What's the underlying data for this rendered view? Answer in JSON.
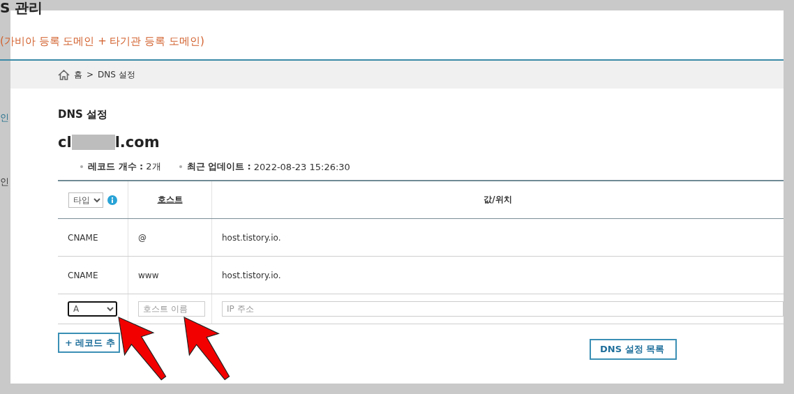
{
  "page_title": "S 관리",
  "subtitle": "(가비아 등록 도메인 + 타기관 등록 도메인)",
  "sidebar": {
    "items": [
      {
        "label": "인",
        "selected": true
      },
      {
        "label": "인",
        "selected": false
      }
    ]
  },
  "breadcrumb": {
    "items": [
      "홈",
      "DNS 설정"
    ],
    "separator": ">"
  },
  "section_title": "DNS 설정",
  "domain": {
    "prefix": "cl",
    "suffix": "l.com"
  },
  "stats": [
    {
      "label": "레코드 개수 :",
      "value": "2개"
    },
    {
      "label": "최근 업데이트 :",
      "value": "2022-08-23 15:26:30"
    }
  ],
  "table": {
    "type_filter": "타입",
    "columns": [
      "호스트",
      "값/위치"
    ],
    "rows": [
      {
        "type": "CNAME",
        "host": "@",
        "value": "host.tistory.io."
      },
      {
        "type": "CNAME",
        "host": "www",
        "value": "host.tistory.io."
      }
    ],
    "new_record": {
      "type": "A",
      "focused": true,
      "host_placeholder": "호스트 이름",
      "value_placeholder": "IP 주소"
    }
  },
  "buttons": [
    {
      "label": "+ 레코드 추",
      "kind": "add"
    },
    {
      "label": "DNS 설정 목록",
      "kind": "list"
    }
  ]
}
